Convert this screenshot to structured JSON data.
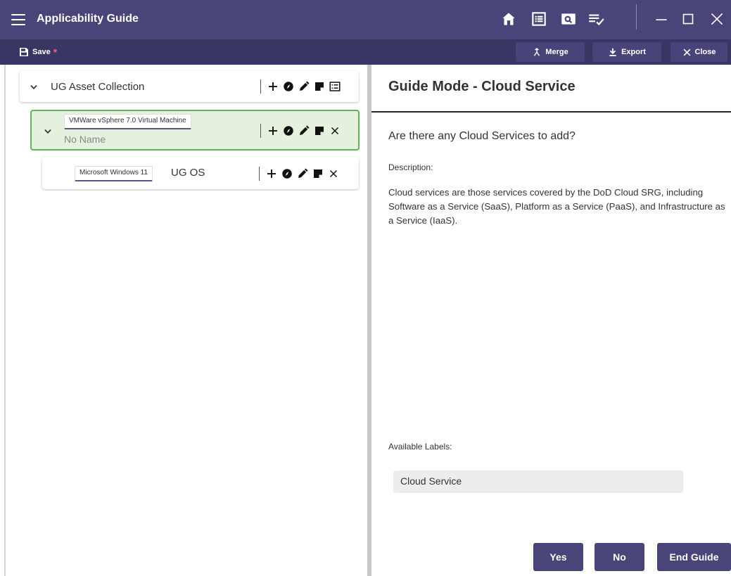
{
  "app": {
    "title": "Applicability Guide"
  },
  "toolbar": {
    "save_label": "Save",
    "save_dirty_marker": "*",
    "merge_label": "Merge",
    "export_label": "Export",
    "close_label": "Close"
  },
  "tree": {
    "root": {
      "label": "UG Asset Collection"
    },
    "child": {
      "type": "VMWare vSphere 7.0 Virtual Machine",
      "name": "No Name"
    },
    "grandchild": {
      "type": "Microsoft Windows 11",
      "name": "UG OS"
    }
  },
  "guide": {
    "title": "Guide Mode - Cloud Service",
    "question": "Are there any Cloud Services to add?",
    "description_label": "Description:",
    "description": "Cloud services are those services covered by the DoD Cloud SRG, including Software as a Service (SaaS), Platform as a Service (PaaS), and Infrastructure as a Service (IaaS).",
    "labels_label": "Available Labels:",
    "labels": [
      "Cloud Service"
    ],
    "yes_label": "Yes",
    "no_label": "No",
    "end_label": "End Guide"
  },
  "colors": {
    "titlebar": "#4a4578",
    "toolbar": "#3a3663",
    "accent_button": "#4a4578",
    "selected_node_bg": "#e3f1de",
    "selected_node_border": "#5fb35a",
    "dirty_marker": "#ff5a6e"
  },
  "icons": {
    "titlebar": [
      "menu-icon",
      "home-icon",
      "list-view-icon",
      "preview-icon",
      "playlist-check-icon",
      "minimize-icon",
      "maximize-icon",
      "close-window-icon"
    ],
    "node_actions": [
      "add-icon",
      "compass-icon",
      "edit-icon",
      "note-icon",
      "list-icon",
      "delete-icon"
    ]
  }
}
